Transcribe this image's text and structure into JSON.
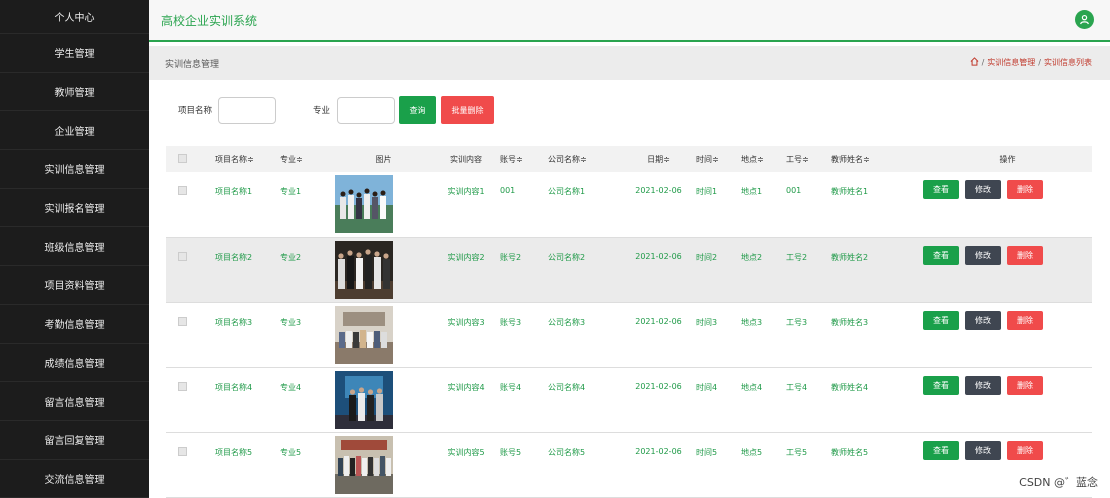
{
  "sidebar": {
    "items": [
      "个人中心",
      "学生管理",
      "教师管理",
      "企业管理",
      "实训信息管理",
      "实训报名管理",
      "班级信息管理",
      "项目资料管理",
      "考勤信息管理",
      "成绩信息管理",
      "留言信息管理",
      "留言回复管理",
      "交流信息管理"
    ]
  },
  "header": {
    "title": "高校企业实训系统",
    "user_icon": "user-icon"
  },
  "breadcrumb": {
    "page_title": "实训信息管理",
    "home_icon": "home-icon",
    "path1": "实训信息管理",
    "path2": "实训信息列表",
    "sep": "/"
  },
  "search": {
    "name_label": "项目名称",
    "major_label": "专业",
    "query_btn": "查询",
    "batch_delete_btn": "批量删除"
  },
  "table": {
    "headers": [
      "项目名称≑",
      "专业≑",
      "图片",
      "实训内容",
      "账号≑",
      "公司名称≑",
      "日期≑",
      "时间≑",
      "地点≑",
      "工号≑",
      "教师姓名≑",
      "操作"
    ],
    "actions": {
      "view": "查看",
      "edit": "修改",
      "delete": "删除"
    },
    "rows": [
      {
        "name": "项目名称1",
        "major": "专业1",
        "content": "实训内容1",
        "account": "001",
        "company": "公司名称1",
        "date": "2021-02-06",
        "time": "时间1",
        "place": "地点1",
        "job_no": "001",
        "teacher": "教师姓名1"
      },
      {
        "name": "项目名称2",
        "major": "专业2",
        "content": "实训内容2",
        "account": "账号2",
        "company": "公司名称2",
        "date": "2021-02-06",
        "time": "时间2",
        "place": "地点2",
        "job_no": "工号2",
        "teacher": "教师姓名2"
      },
      {
        "name": "项目名称3",
        "major": "专业3",
        "content": "实训内容3",
        "account": "账号3",
        "company": "公司名称3",
        "date": "2021-02-06",
        "time": "时间3",
        "place": "地点3",
        "job_no": "工号3",
        "teacher": "教师姓名3"
      },
      {
        "name": "项目名称4",
        "major": "专业4",
        "content": "实训内容4",
        "account": "账号4",
        "company": "公司名称4",
        "date": "2021-02-06",
        "time": "时间4",
        "place": "地点4",
        "job_no": "工号4",
        "teacher": "教师姓名4"
      },
      {
        "name": "项目名称5",
        "major": "专业5",
        "content": "实训内容5",
        "account": "账号5",
        "company": "公司名称5",
        "date": "2021-02-06",
        "time": "时间5",
        "place": "地点5",
        "job_no": "工号5",
        "teacher": "教师姓名5"
      }
    ]
  },
  "watermark": "CSDN @゛蓝念",
  "colors": {
    "accent": "#2aa44f",
    "sidebar_bg": "#1c1c1c",
    "danger": "#f04b4b",
    "dark_btn": "#3f4651"
  }
}
